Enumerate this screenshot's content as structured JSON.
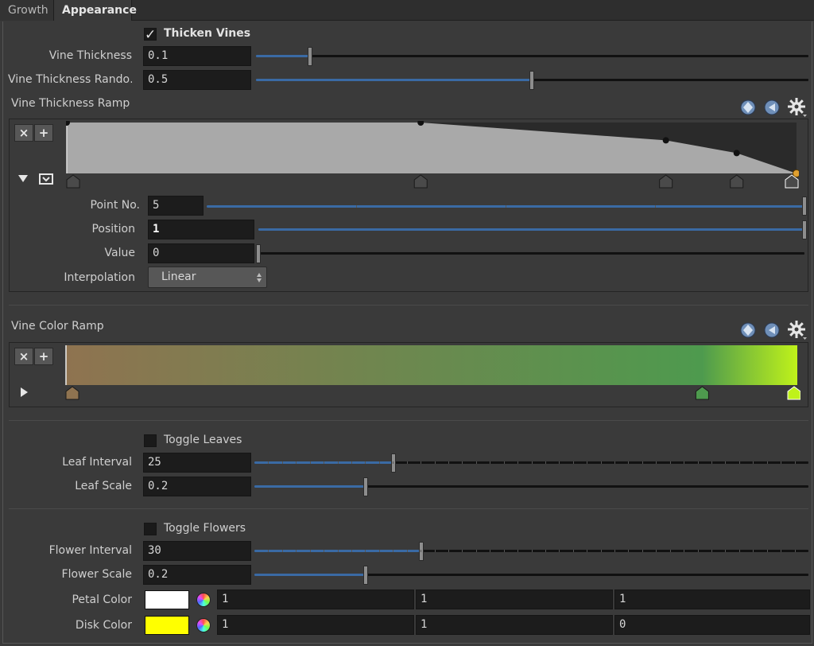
{
  "tabs": [
    {
      "label": "Growth",
      "active": false
    },
    {
      "label": "Appearance",
      "active": true
    }
  ],
  "thicken": {
    "label": "Thicken Vines",
    "checked": true
  },
  "vine_thickness": {
    "label": "Vine Thickness",
    "value": "0.1",
    "fraction": 0.1
  },
  "vine_thickness_random": {
    "label": "Vine Thickness Rando…",
    "value": "0.5",
    "fraction": 0.5
  },
  "thickness_ramp": {
    "label": "Vine Thickness Ramp",
    "points": [
      {
        "pos": 0.0,
        "value": 1.0
      },
      {
        "pos": 0.485,
        "value": 1.0
      },
      {
        "pos": 0.821,
        "value": 0.65
      },
      {
        "pos": 0.918,
        "value": 0.4
      },
      {
        "pos": 1.0,
        "value": 0.0
      }
    ],
    "selected_index": 4,
    "point_no": {
      "label": "Point No.",
      "value": "5"
    },
    "position": {
      "label": "Position",
      "value": "1"
    },
    "value": {
      "label": "Value",
      "value": "0"
    },
    "interpolation": {
      "label": "Interpolation",
      "value": "Linear"
    }
  },
  "color_ramp": {
    "label": "Vine Color Ramp",
    "stops": [
      {
        "pos": 0.0,
        "color": "#8f7350"
      },
      {
        "pos": 0.87,
        "color": "#4e9a4e"
      },
      {
        "pos": 1.0,
        "color": "#bff21a"
      }
    ]
  },
  "leaves": {
    "toggle_label": "Toggle Leaves",
    "interval": {
      "label": "Leaf Interval",
      "value": "25",
      "fraction": 0.25
    },
    "scale": {
      "label": "Leaf Scale",
      "value": "0.2",
      "fraction": 0.2
    }
  },
  "flowers": {
    "toggle_label": "Toggle Flowers",
    "interval": {
      "label": "Flower Interval",
      "value": "30",
      "fraction": 0.3
    },
    "scale": {
      "label": "Flower Scale",
      "value": "0.2",
      "fraction": 0.2
    },
    "petal": {
      "label": "Petal Color",
      "swatch": "#ffffff",
      "r": "1",
      "g": "1",
      "b": "1"
    },
    "disk": {
      "label": "Disk Color",
      "swatch": "#ffff00",
      "r": "1",
      "g": "1",
      "b": "0"
    }
  },
  "colors": {
    "slider_fill": "#3a6aa4",
    "field_bg": "#1c1c1c",
    "panel_bg": "#3a3a3a",
    "selected_point": "#e0a030"
  }
}
